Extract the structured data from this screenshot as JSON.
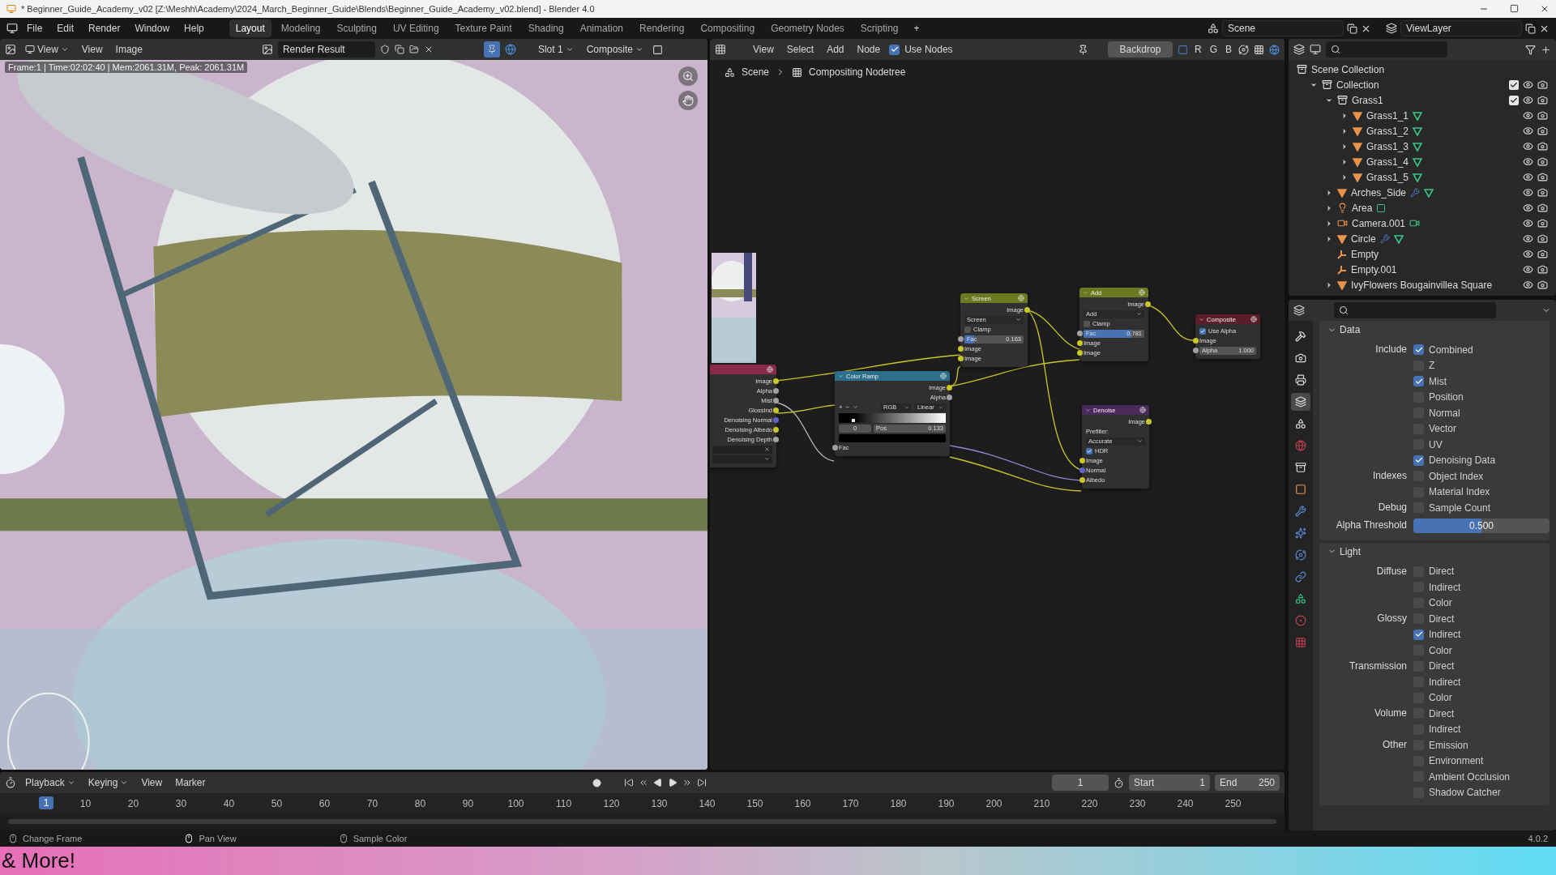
{
  "window": {
    "title": "* Beginner_Guide_Academy_v02 [Z:\\Meshh\\Academy\\2024_March_Beginner_Guide\\Blends\\Beginner_Guide_Academy_v02.blend] - Blender 4.0"
  },
  "menu": [
    "File",
    "Edit",
    "Render",
    "Window",
    "Help"
  ],
  "workspaces": [
    {
      "label": "Layout",
      "selected": true
    },
    {
      "label": "Modeling",
      "selected": false
    },
    {
      "label": "Sculpting",
      "selected": false
    },
    {
      "label": "UV Editing",
      "selected": false
    },
    {
      "label": "Texture Paint",
      "selected": false
    },
    {
      "label": "Shading",
      "selected": false
    },
    {
      "label": "Animation",
      "selected": false
    },
    {
      "label": "Rendering",
      "selected": false
    },
    {
      "label": "Compositing",
      "selected": false
    },
    {
      "label": "Geometry Nodes",
      "selected": false
    },
    {
      "label": "Scripting",
      "selected": false
    }
  ],
  "add_workspace": "+",
  "scene": "Scene",
  "view_layer": "ViewLayer",
  "image_editor": {
    "mode": "View",
    "menus": [
      "View",
      "Image"
    ],
    "image": "Render Result",
    "slot": "Slot 1",
    "pass": "Composite",
    "info": "Frame:1 | Time:02:02:40 | Mem:2061.31M, Peak: 2061.31M"
  },
  "node_editor": {
    "menus": [
      "View",
      "Select",
      "Add",
      "Node"
    ],
    "use_nodes": {
      "label": "Use Nodes",
      "checked": true
    },
    "backdrop": "Backdrop",
    "channels": [
      "R",
      "G",
      "B"
    ],
    "breadcrumbs": [
      "Scene",
      "Compositing Nodetree"
    ],
    "nodes": [
      {
        "color": "#8a2a4a",
        "rows": [
          {
            "kind": "out",
            "label": "Image",
            "color": "#c7c729"
          },
          {
            "kind": "out",
            "label": "Alpha",
            "color": "#a1a1a1"
          },
          {
            "kind": "out",
            "label": "Mist",
            "color": "#a1a1a1"
          },
          {
            "kind": "out",
            "label": "GlossInd",
            "color": "#c7c729"
          },
          {
            "kind": "out",
            "label": "Denoising Normal",
            "color": "#6363c7"
          },
          {
            "kind": "out",
            "label": "Denoising Albedo",
            "color": "#c7c729"
          },
          {
            "kind": "out",
            "label": "Denoising Depth",
            "color": "#a1a1a1"
          },
          {
            "kind": "field_clear"
          },
          {
            "kind": "field_select"
          }
        ]
      },
      {
        "title": "Color Ramp",
        "color": "#2b6f8a",
        "rows": [
          {
            "kind": "out",
            "label": "Image",
            "color": "#c7c729"
          },
          {
            "kind": "out",
            "label": "Alpha",
            "color": "#a1a1a1"
          },
          {
            "kind": "ramp_controls",
            "buttons": [
              "+",
              "−"
            ],
            "mode": "RGB",
            "interpolation": "Linear"
          },
          {
            "kind": "ramp",
            "level": 0.133
          },
          {
            "kind": "pair",
            "index": "0",
            "label": "Pos",
            "value": "0.133"
          },
          {
            "kind": "swatch",
            "color": "#000000"
          },
          {
            "kind": "in",
            "label": "Fac",
            "color": "#a1a1a1"
          }
        ]
      },
      {
        "title": "Screen",
        "color": "#6a7a20",
        "rows": [
          {
            "kind": "out",
            "label": "Image",
            "color": "#c7c729"
          },
          {
            "kind": "select",
            "value": "Screen"
          },
          {
            "kind": "check",
            "label": "Clamp",
            "checked": false
          },
          {
            "kind": "slider",
            "label": "Fac",
            "value": "0.163",
            "level": 0.163,
            "color": "#a1a1a1"
          },
          {
            "kind": "in",
            "label": "Image",
            "color": "#c7c729"
          },
          {
            "kind": "in",
            "label": "Image",
            "color": "#c7c729"
          }
        ]
      },
      {
        "title": "Add",
        "color": "#6a7a20",
        "rows": [
          {
            "kind": "out",
            "label": "Image",
            "color": "#c7c729"
          },
          {
            "kind": "select",
            "value": "Add"
          },
          {
            "kind": "check",
            "label": "Clamp",
            "checked": false
          },
          {
            "kind": "slider",
            "label": "Fac",
            "value": "0.781",
            "level": 0.781,
            "color": "#a1a1a1"
          },
          {
            "kind": "in",
            "label": "Image",
            "color": "#c7c729"
          },
          {
            "kind": "in",
            "label": "Image",
            "color": "#c7c729"
          }
        ]
      },
      {
        "title": "Composite",
        "color": "#5a1e2a",
        "rows": [
          {
            "kind": "check",
            "label": "Use Alpha",
            "checked": true
          },
          {
            "kind": "in",
            "label": "Image",
            "color": "#c7c729"
          },
          {
            "kind": "number",
            "label": "Alpha",
            "value": "1.000",
            "color": "#a1a1a1"
          }
        ]
      },
      {
        "title": "Denoise",
        "color": "#4a2a5a",
        "rows": [
          {
            "kind": "out",
            "label": "Image",
            "color": "#c7c729"
          },
          {
            "kind": "text",
            "label": "Prefilter:"
          },
          {
            "kind": "select",
            "value": "Accurate"
          },
          {
            "kind": "check",
            "label": "HDR",
            "checked": true
          },
          {
            "kind": "in",
            "label": "Image",
            "color": "#c7c729"
          },
          {
            "kind": "in",
            "label": "Normal",
            "color": "#6363c7"
          },
          {
            "kind": "in",
            "label": "Albedo",
            "color": "#c7c729"
          }
        ]
      }
    ]
  },
  "outliner": {
    "root": "Scene Collection",
    "items": [
      {
        "label": "Collection",
        "kind": "collection",
        "expanded": true,
        "checked": true,
        "children": [
          {
            "label": "Grass1",
            "kind": "collection",
            "expanded": true,
            "checked": true,
            "children": [
              {
                "label": "Grass1_1",
                "kind": "mesh",
                "expanded": false,
                "data": [
                  {
                    "kind": "mesh"
                  }
                ]
              },
              {
                "label": "Grass1_2",
                "kind": "mesh",
                "expanded": false,
                "data": [
                  {
                    "kind": "mesh"
                  }
                ]
              },
              {
                "label": "Grass1_3",
                "kind": "mesh",
                "expanded": false,
                "data": [
                  {
                    "kind": "mesh"
                  }
                ]
              },
              {
                "label": "Grass1_4",
                "kind": "mesh",
                "expanded": false,
                "data": [
                  {
                    "kind": "mesh"
                  }
                ]
              },
              {
                "label": "Grass1_5",
                "kind": "mesh",
                "expanded": false,
                "data": [
                  {
                    "kind": "mesh"
                  }
                ]
              }
            ]
          },
          {
            "label": "Arches_Side",
            "kind": "mesh",
            "expanded": false,
            "data": [
              {
                "kind": "modifier"
              },
              {
                "kind": "mesh"
              }
            ]
          },
          {
            "label": "Area",
            "kind": "light",
            "expanded": false,
            "data": [
              {
                "kind": "light"
              }
            ]
          },
          {
            "label": "Camera.001",
            "kind": "camera",
            "expanded": false,
            "data": [
              {
                "kind": "camera"
              }
            ]
          },
          {
            "label": "Circle",
            "kind": "mesh",
            "expanded": false,
            "data": [
              {
                "kind": "modifier"
              },
              {
                "kind": "mesh"
              }
            ]
          },
          {
            "label": "Empty",
            "kind": "empty"
          },
          {
            "label": "Empty.001",
            "kind": "empty"
          },
          {
            "label": "IvyFlowers Bougainvillea Square",
            "kind": "mesh",
            "expanded": false
          }
        ]
      }
    ]
  },
  "properties": {
    "tabs": [
      {
        "kind": "tool",
        "selected": false
      },
      {
        "kind": "render",
        "selected": false
      },
      {
        "kind": "output",
        "selected": false
      },
      {
        "kind": "view_layer",
        "selected": true
      },
      {
        "kind": "scene",
        "selected": false
      },
      {
        "kind": "world",
        "selected": false
      },
      {
        "kind": "collection",
        "selected": false
      },
      {
        "kind": "object",
        "selected": false
      },
      {
        "kind": "modifiers",
        "selected": false
      },
      {
        "kind": "particles",
        "selected": false
      },
      {
        "kind": "physics",
        "selected": false
      },
      {
        "kind": "constraints",
        "selected": false
      },
      {
        "kind": "data",
        "selected": false
      },
      {
        "kind": "material",
        "selected": false
      },
      {
        "kind": "texture",
        "selected": false
      }
    ],
    "sections": [
      {
        "title": "Data",
        "expanded": true,
        "groups": [
          {
            "kind": "checks",
            "label": "Include",
            "options": [
              {
                "label": "Combined",
                "checked": true
              },
              {
                "label": "Z",
                "checked": false
              },
              {
                "label": "Mist",
                "checked": true
              },
              {
                "label": "Position",
                "checked": false
              },
              {
                "label": "Normal",
                "checked": false
              },
              {
                "label": "Vector",
                "checked": false
              },
              {
                "label": "UV",
                "checked": false
              },
              {
                "label": "Denoising Data",
                "checked": true
              }
            ]
          },
          {
            "kind": "checks",
            "label": "Indexes",
            "options": [
              {
                "label": "Object Index",
                "checked": false
              },
              {
                "label": "Material Index",
                "checked": false
              }
            ]
          },
          {
            "kind": "checks",
            "label": "Debug",
            "options": [
              {
                "label": "Sample Count",
                "checked": false
              }
            ]
          },
          {
            "kind": "slider",
            "label": "Alpha Threshold",
            "value": "0.500",
            "level": 0.5
          }
        ]
      },
      {
        "title": "Light",
        "expanded": true,
        "groups": [
          {
            "kind": "checks",
            "label": "Diffuse",
            "options": [
              {
                "label": "Direct",
                "checked": false
              },
              {
                "label": "Indirect",
                "checked": false
              },
              {
                "label": "Color",
                "checked": false
              }
            ]
          },
          {
            "kind": "checks",
            "label": "Glossy",
            "options": [
              {
                "label": "Direct",
                "checked": false
              },
              {
                "label": "Indirect",
                "checked": true
              },
              {
                "label": "Color",
                "checked": false
              }
            ]
          },
          {
            "kind": "checks",
            "label": "Transmission",
            "options": [
              {
                "label": "Direct",
                "checked": false
              },
              {
                "label": "Indirect",
                "checked": false
              },
              {
                "label": "Color",
                "checked": false
              }
            ]
          },
          {
            "kind": "checks",
            "label": "Volume",
            "options": [
              {
                "label": "Direct",
                "checked": false
              },
              {
                "label": "Indirect",
                "checked": false
              }
            ]
          },
          {
            "kind": "checks",
            "label": "Other",
            "options": [
              {
                "label": "Emission",
                "checked": false
              },
              {
                "label": "Environment",
                "checked": false
              },
              {
                "label": "Ambient Occlusion",
                "checked": false
              },
              {
                "label": "Shadow Catcher",
                "checked": false
              }
            ]
          }
        ]
      }
    ]
  },
  "timeline": {
    "menus": [
      "Playback",
      "Keying",
      "View",
      "Marker"
    ],
    "playhead": "1",
    "current_frame": "1",
    "start_label": "Start",
    "start": "1",
    "end_label": "End",
    "end": "250",
    "ticks": [
      "10",
      "20",
      "30",
      "40",
      "50",
      "60",
      "70",
      "80",
      "90",
      "100",
      "110",
      "120",
      "130",
      "140",
      "150",
      "160",
      "170",
      "180",
      "190",
      "200",
      "210",
      "220",
      "230",
      "240",
      "250"
    ]
  },
  "status_bar": {
    "hints": [
      {
        "kind": "left",
        "label": "Change Frame"
      },
      {
        "kind": "middle",
        "label": "Pan View"
      },
      {
        "kind": "right",
        "label": "Sample Color"
      }
    ],
    "version": "4.0.2"
  },
  "banner": {
    "text": "& More!"
  }
}
